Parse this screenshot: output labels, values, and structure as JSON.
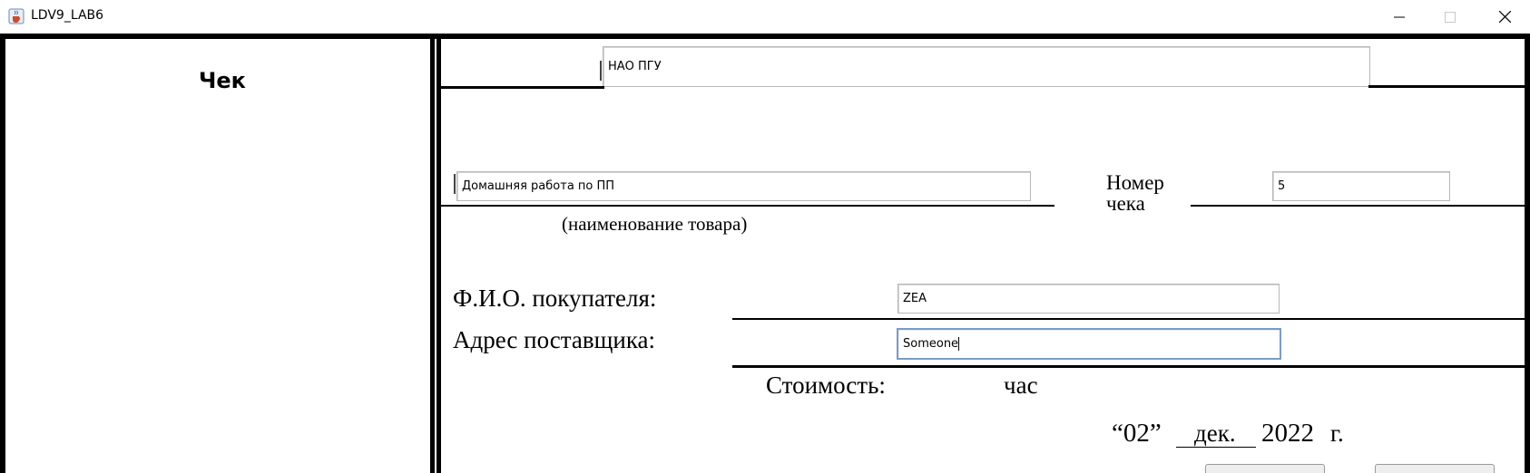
{
  "window": {
    "title": "LDV9_LAB6",
    "app_icon": "java-cup-icon",
    "controls": [
      "minimize-icon",
      "maximize-icon",
      "close-icon"
    ]
  },
  "left_panel": {
    "label": "Чек"
  },
  "form": {
    "organization": {
      "value": "НАО ПГУ"
    },
    "product": {
      "value": "Домашняя работа по ПП",
      "caption": "(наименование товара)"
    },
    "receipt_number": {
      "label_line1": "Номер",
      "label_line2": "чека",
      "value": "5"
    },
    "buyer": {
      "label": "Ф.И.О. покупателя:",
      "value": "ZEA"
    },
    "supplier": {
      "label": "Адрес поставщика:",
      "value": "Someone"
    },
    "cost": {
      "label": "Стоимость:",
      "unit": "час"
    },
    "date": {
      "day": "“02”",
      "month": "дек.",
      "year": "2022",
      "suffix": "г."
    }
  },
  "colors": {
    "frame": "#000000",
    "field_border": "#b8b8b8",
    "focus_border": "#7a9cc6"
  }
}
